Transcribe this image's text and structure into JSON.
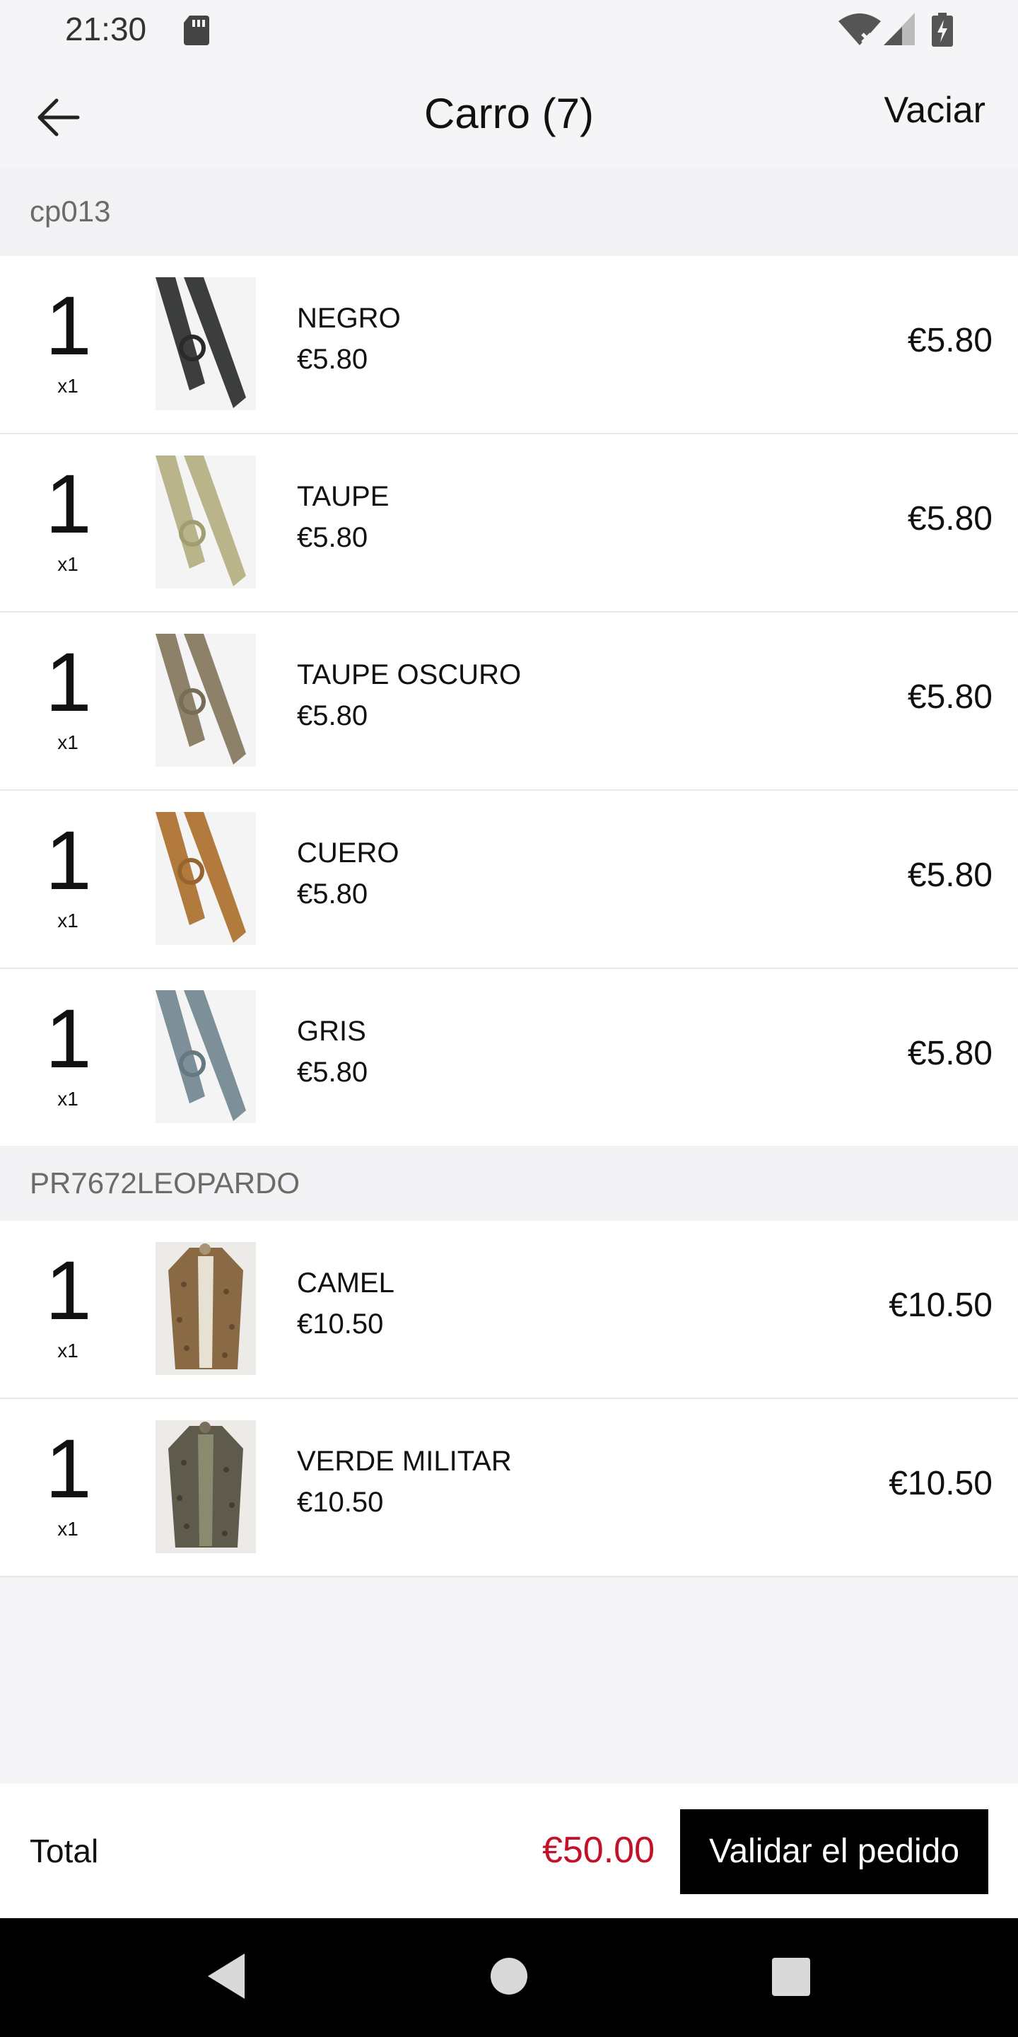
{
  "status_bar": {
    "time": "21:30"
  },
  "header": {
    "title": "Carro (7)",
    "clear_label": "Vaciar"
  },
  "groups": [
    {
      "name": "cp013"
    },
    {
      "name": "PR7672LEOPARDO"
    }
  ],
  "items": [
    {
      "qty": "1",
      "qty_multiplier": "x1",
      "name": "NEGRO",
      "unit_price": "€5.80",
      "line_total": "€5.80",
      "thumb_color": "#3c3e3d"
    },
    {
      "qty": "1",
      "qty_multiplier": "x1",
      "name": "TAUPE",
      "unit_price": "€5.80",
      "line_total": "€5.80",
      "thumb_color": "#b9b48a"
    },
    {
      "qty": "1",
      "qty_multiplier": "x1",
      "name": "TAUPE OSCURO",
      "unit_price": "€5.80",
      "line_total": "€5.80",
      "thumb_color": "#8d8169"
    },
    {
      "qty": "1",
      "qty_multiplier": "x1",
      "name": "CUERO",
      "unit_price": "€5.80",
      "line_total": "€5.80",
      "thumb_color": "#b27a3d"
    },
    {
      "qty": "1",
      "qty_multiplier": "x1",
      "name": "GRIS",
      "unit_price": "€5.80",
      "line_total": "€5.80",
      "thumb_color": "#7d8f98"
    },
    {
      "qty": "1",
      "qty_multiplier": "x1",
      "name": "CAMEL",
      "unit_price": "€10.50",
      "line_total": "€10.50",
      "thumb_color": "#8a6a45"
    },
    {
      "qty": "1",
      "qty_multiplier": "x1",
      "name": "VERDE MILITAR",
      "unit_price": "€10.50",
      "line_total": "€10.50",
      "thumb_color": "#5e5a4c"
    }
  ],
  "footer": {
    "total_label": "Total",
    "total_value": "€50.00",
    "validate_label": "Validar el pedido"
  },
  "colors": {
    "accent_price": "#c5102a",
    "button_bg": "#000000"
  }
}
